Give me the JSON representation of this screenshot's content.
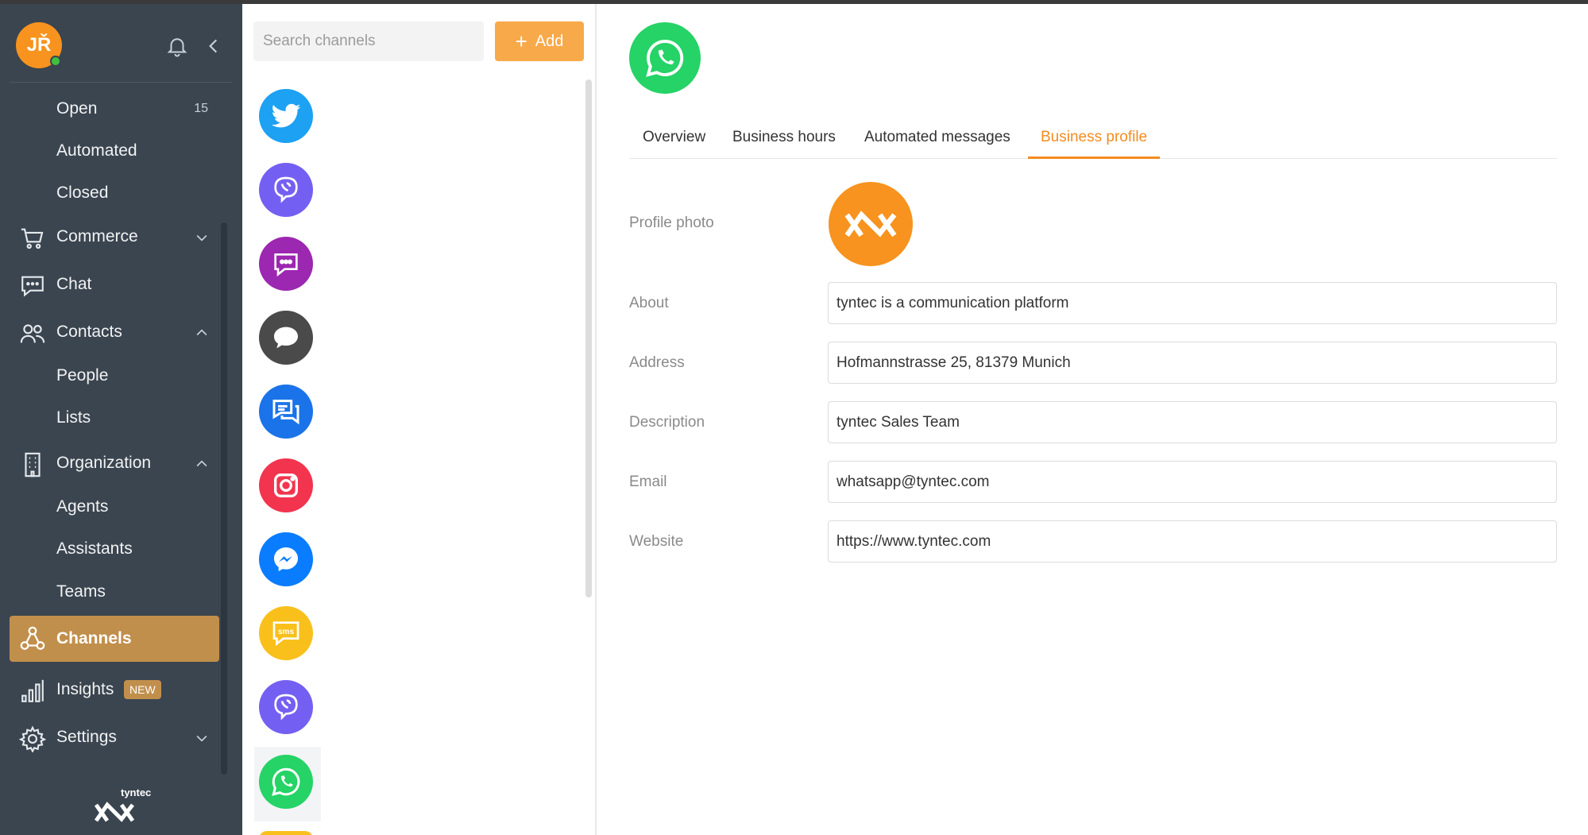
{
  "user": {
    "initials": "JŘ",
    "status_color": "#3fc13f"
  },
  "sidebar": {
    "items": [
      {
        "label": "Open",
        "count": "15"
      },
      {
        "label": "Automated"
      },
      {
        "label": "Closed"
      },
      {
        "label": "Commerce",
        "icon": "cart-icon"
      },
      {
        "label": "Chat",
        "icon": "chat-bubble-icon"
      },
      {
        "label": "Contacts",
        "icon": "users-icon"
      },
      {
        "label": "People"
      },
      {
        "label": "Lists"
      },
      {
        "label": "Organization",
        "icon": "building-icon"
      },
      {
        "label": "Agents"
      },
      {
        "label": "Assistants"
      },
      {
        "label": "Teams"
      },
      {
        "label": "Channels",
        "icon": "channels-icon",
        "active": true
      },
      {
        "label": "Insights",
        "icon": "bar-chart-icon",
        "badge": "NEW"
      },
      {
        "label": "Settings",
        "icon": "gear-icon"
      }
    ],
    "brand": "tyntec",
    "colors": {
      "bg": "#3a4550",
      "active": "#c18f4c"
    }
  },
  "channels": {
    "search_placeholder": "Search channels",
    "add_label": "Add",
    "list": [
      {
        "icon": "twitter-icon",
        "color": "#1da1f2"
      },
      {
        "icon": "viber-icon",
        "color": "#7360f2"
      },
      {
        "icon": "message-dots-icon",
        "color": "#9c27b0"
      },
      {
        "icon": "speech-bubble-icon",
        "color": "#4a4a4a"
      },
      {
        "icon": "conversation-icon",
        "color": "#1a73e8"
      },
      {
        "icon": "instagram-icon",
        "color": "#f2344f"
      },
      {
        "icon": "messenger-icon",
        "color": "#0a7cff"
      },
      {
        "icon": "sms-icon",
        "color": "#f9c01c"
      },
      {
        "icon": "viber-icon",
        "color": "#7360f2"
      },
      {
        "icon": "whatsapp-icon",
        "color": "#25d366",
        "selected": true
      }
    ]
  },
  "main": {
    "tabs": [
      {
        "label": "Overview"
      },
      {
        "label": "Business hours"
      },
      {
        "label": "Automated messages"
      },
      {
        "label": "Business profile",
        "active": true
      }
    ],
    "profile_photo_label": "Profile photo",
    "fields": [
      {
        "label": "About",
        "value": "tyntec is a communication platform"
      },
      {
        "label": "Address",
        "value": "Hofmannstrasse 25, 81379 Munich"
      },
      {
        "label": "Description",
        "value": "tyntec Sales Team"
      },
      {
        "label": "Email",
        "value": "whatsapp@tyntec.com"
      },
      {
        "label": "Website",
        "value": "https://www.tyntec.com"
      }
    ],
    "accent": "#f38c1f"
  }
}
